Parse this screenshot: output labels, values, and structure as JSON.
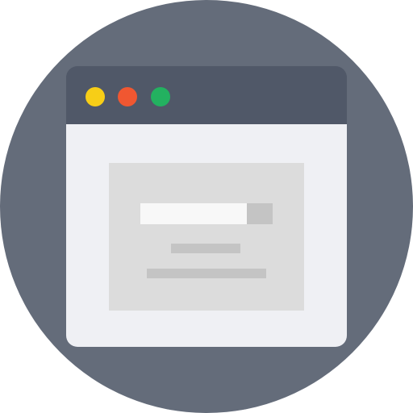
{
  "icon": {
    "semantic_name": "browser-window-icon",
    "colors": {
      "background_circle": "#646c7a",
      "titlebar": "#505868",
      "window_body": "#eff0f4",
      "panel": "#dcdcdc",
      "input_field": "#f8f8f8",
      "input_button": "#c4c4c4",
      "text_line": "#c4c4c4",
      "dot_yellow": "#f7ce17",
      "dot_red": "#f05731",
      "dot_green": "#23b160"
    },
    "window_controls": [
      "yellow-dot-icon",
      "red-dot-icon",
      "green-dot-icon"
    ]
  }
}
